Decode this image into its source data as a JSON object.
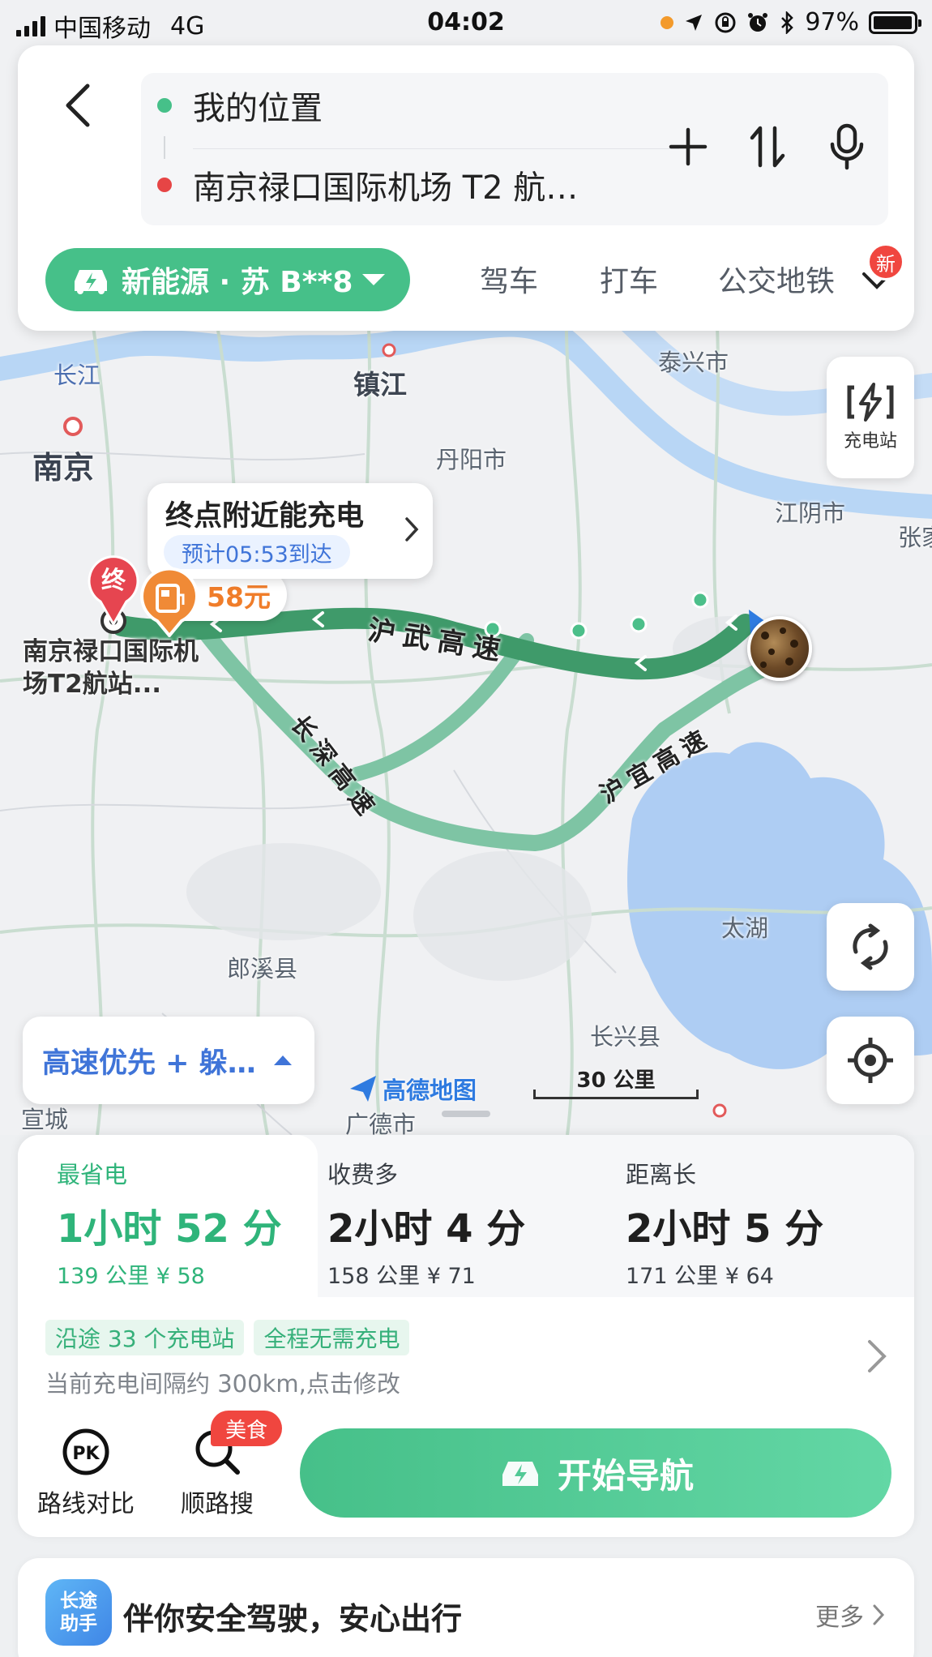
{
  "status": {
    "carrier": "中国移动",
    "network": "4G",
    "time": "04:02",
    "battery": "97%"
  },
  "search": {
    "origin": "我的位置",
    "destination": "南京禄口国际机场 T2 航…"
  },
  "modes": {
    "energy_chip": "新能源 · 苏 B**8",
    "tabs": [
      "驾车",
      "打车",
      "公交地铁"
    ],
    "new_badge": "新"
  },
  "map": {
    "labels": {
      "changjiang": "长江",
      "nanjing": "南京",
      "zhenjiang": "镇江",
      "taixing": "泰兴市",
      "danyang": "丹阳市",
      "jiangyin": "江阴市",
      "zhang": "张家",
      "lixi": "郎溪县",
      "taihu": "太湖",
      "changxing": "长兴县",
      "xuancheng": "宣城",
      "guangde": "广德市"
    },
    "roads": {
      "huwu": "沪 武 高 速",
      "changshen": "长 深 高 速",
      "huyi": "沪 宜 高 速"
    },
    "charging_station_label": "充电站",
    "callout_title": "终点附近能充电",
    "callout_eta": "预计05:53到达",
    "price_tag": "58元",
    "end_pin_char": "终",
    "destination_label": "南京禄口国际机场T2航站...",
    "strategy": "高速优先 + 躲…",
    "logo": "高德地图",
    "scale": "30 公里"
  },
  "routes": [
    {
      "tag": "最省电",
      "time": "1小时 52 分",
      "sub": "139 公里  ¥ 58",
      "selected": true
    },
    {
      "tag": "收费多",
      "time": "2小时 4 分",
      "sub": "158 公里  ¥ 71",
      "selected": false
    },
    {
      "tag": "距离长",
      "time": "2小时 5 分",
      "sub": "171 公里  ¥ 64",
      "selected": false
    }
  ],
  "charge_info": {
    "tags": [
      "沿途 33 个充电站",
      "全程无需充电"
    ],
    "desc": "当前充电间隔约 300km,点击修改"
  },
  "actions": {
    "compare": "路线对比",
    "search_along": "顺路搜",
    "food_badge": "美食",
    "start_nav": "开始导航"
  },
  "assistant": {
    "logo_line1": "长途",
    "logo_line2": "助手",
    "text": "伴你安全驾驶，安心出行",
    "more": "更多"
  },
  "colors": {
    "accent_green": "#46c089",
    "route_dark": "#3f9a6a",
    "route_light": "#7ec4a4",
    "water": "#b8d6f5",
    "link_blue": "#3f74d8"
  }
}
